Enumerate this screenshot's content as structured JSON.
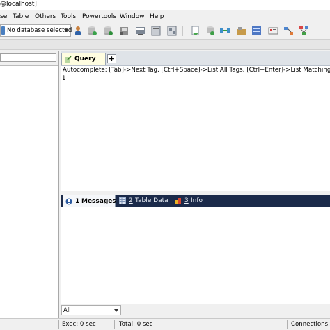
{
  "window": {
    "title": "@localhost]"
  },
  "menu": [
    "se",
    "Table",
    "Others",
    "Tools",
    "Powertools",
    "Window",
    "Help"
  ],
  "toolbar": {
    "database_select": "No database selected",
    "buttons": [
      "user-manager-icon",
      "backup-icon",
      "restore-icon",
      "import-icon",
      "schema-sync-icon",
      "scheduled-job-icon",
      "data-sync-icon",
      "export-icon",
      "refresh-icon",
      "transfer-icon",
      "query-builder-icon",
      "schema-designer-icon",
      "profiler-icon",
      "visual-explain-icon",
      "diagram-icon"
    ]
  },
  "object_browser": {
    "filter_value": ""
  },
  "query": {
    "tab_label": "Query",
    "new_tab_label": "+",
    "autocomplete_hint": "Autocomplete: [Tab]->Next Tag. [Ctrl+Space]->List All Tags. [Ctrl+Enter]->List Matching Tag",
    "line_numbers": [
      "1"
    ]
  },
  "results": {
    "tabs": [
      {
        "number": "1",
        "label": "Messages",
        "icon": "messages-icon"
      },
      {
        "number": "2",
        "label": "Table Data",
        "icon": "table-data-icon"
      },
      {
        "number": "3",
        "label": "Info",
        "icon": "info-icon"
      }
    ],
    "filter_select": "All"
  },
  "status": {
    "exec": "Exec: 0 sec",
    "total": "Total: 0 sec",
    "connections": "Connections:"
  },
  "colors": {
    "result_tab_bar": "#1b2a4a",
    "query_tab_bg": "#fffde0",
    "window_bg": "#f0f0f0"
  }
}
